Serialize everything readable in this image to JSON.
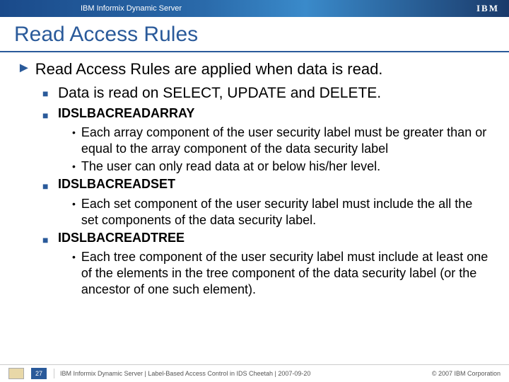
{
  "header": {
    "product": "IBM Informix Dynamic Server",
    "logo": "IBM"
  },
  "title": "Read Access Rules",
  "main": "Read Access Rules are applied when data is read.",
  "sub_intro": "Data is read on SELECT, UPDATE and DELETE.",
  "rules": [
    {
      "name": "IDSLBACREADARRAY",
      "points": [
        "Each array component of the user security label must be greater than or equal to the array component of the data security label",
        "The user can only read data at or below his/her level."
      ]
    },
    {
      "name": "IDSLBACREADSET",
      "points": [
        "Each set component of the user security label must include the all the set components of the data security label."
      ]
    },
    {
      "name": "IDSLBACREADTREE",
      "points": [
        "Each tree component of the user security label must include at least one of the elements in the tree component of the data security label (or the ancestor of one such element)."
      ]
    }
  ],
  "footer": {
    "page": "27",
    "text": "IBM Informix Dynamic Server  |  Label-Based Access Control in IDS Cheetah | 2007-09-20",
    "copyright": "© 2007 IBM Corporation"
  }
}
